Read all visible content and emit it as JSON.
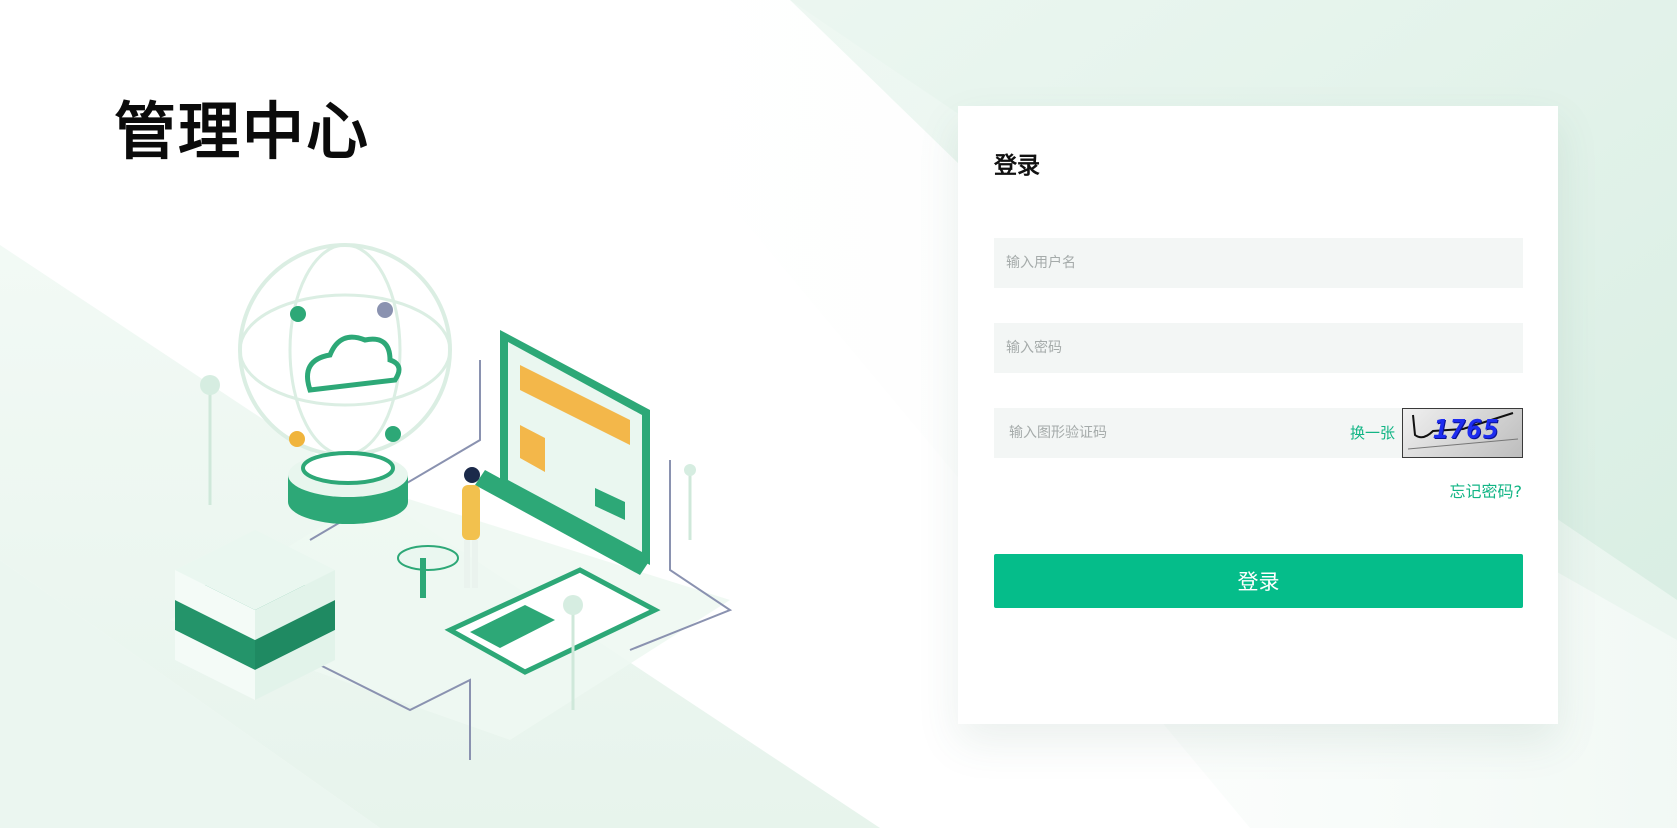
{
  "brand": {
    "title": "管理中心"
  },
  "login": {
    "heading": "登录",
    "username_placeholder": "输入用户名",
    "password_placeholder": "输入密码",
    "captcha_placeholder": "输入图形验证码",
    "refresh_captcha_label": "换一张",
    "captcha_code": "1765",
    "forgot_label": "忘记密码?",
    "submit_label": "登录"
  },
  "colors": {
    "accent": "#05bd8a",
    "link": "#12b585",
    "input_bg": "#f3f6f5"
  }
}
